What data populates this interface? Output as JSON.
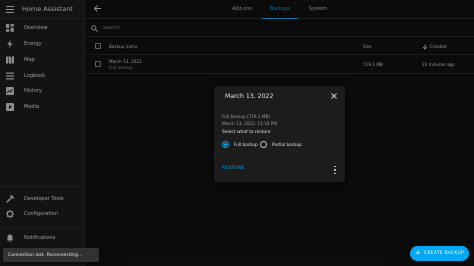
{
  "sidebar": {
    "title": "Home Assistant",
    "items": [
      {
        "label": "Overview",
        "icon": "grid-icon"
      },
      {
        "label": "Energy",
        "icon": "lightning-icon"
      },
      {
        "label": "Map",
        "icon": "map-icon"
      },
      {
        "label": "Logbook",
        "icon": "list-icon"
      },
      {
        "label": "History",
        "icon": "chart-icon"
      },
      {
        "label": "Media",
        "icon": "play-icon"
      }
    ],
    "bottom_items": [
      {
        "label": "Developer Tools",
        "icon": "hammer-icon"
      },
      {
        "label": "Configuration",
        "icon": "gear-icon"
      },
      {
        "label": "Notifications",
        "icon": "bell-icon"
      }
    ]
  },
  "tabs": [
    {
      "label": "Add-ons"
    },
    {
      "label": "Backups"
    },
    {
      "label": "System"
    }
  ],
  "active_tab": "Backups",
  "search": {
    "placeholder": "Search"
  },
  "table": {
    "columns": {
      "name": "Backup name",
      "size": "Size",
      "created": "Created"
    },
    "rows": [
      {
        "name": "March 13, 2022",
        "type": "Full backup",
        "size": "719.1 MB",
        "created": "22 minutes ago"
      }
    ]
  },
  "dialog": {
    "title": "March 13, 2022",
    "info_line1": "Full backup (719.1 MB)",
    "info_line2": "March 13, 2022, 11:19 PM",
    "prompt": "Select what to restore",
    "option_full": "Full backup",
    "option_partial": "Partial backup",
    "selected": "Full backup",
    "restore_label": "RESTORE"
  },
  "toast": {
    "message": "Connection lost. Reconnecting…"
  },
  "fab": {
    "label": "CREATE BACKUP"
  },
  "colors": {
    "accent": "#03a9f4",
    "background": "#111111",
    "sidebar": "#1c1c1c",
    "dialog": "#1c1c1c"
  }
}
